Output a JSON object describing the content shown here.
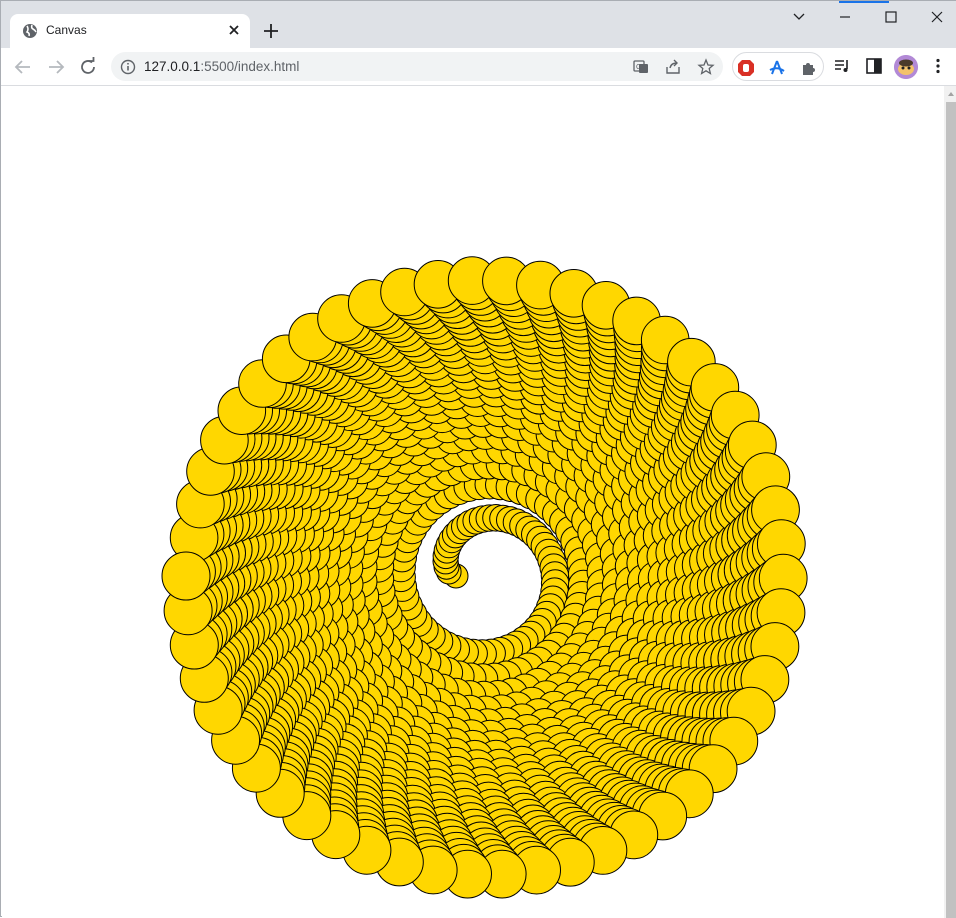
{
  "browser": {
    "tab": {
      "title": "Canvas",
      "favicon": "globe-icon",
      "close_icon": "close-icon"
    },
    "new_tab_icon": "plus-icon",
    "window_controls": [
      "chevron-down-icon",
      "minimize-icon",
      "maximize-icon",
      "close-icon"
    ],
    "nav": [
      "back-icon",
      "forward-icon",
      "reload-icon"
    ],
    "address": {
      "host": "127.0.0.1",
      "path": ":5500/index.html",
      "info_icon": "info-icon"
    },
    "omnibox_icons": [
      "translate-icon",
      "share-icon",
      "star-icon"
    ],
    "extensions": [
      "ublock-icon",
      "acrobat-icon",
      "puzzle-icon"
    ],
    "toolbar_icons": [
      "media-queue-icon",
      "side-panel-icon",
      "profile-avatar",
      "more-menu-icon"
    ]
  },
  "canvas": {
    "pattern": "spiral-of-circles",
    "fill_color": "#FFD700",
    "stroke_color": "#000000",
    "background": "#ffffff"
  }
}
